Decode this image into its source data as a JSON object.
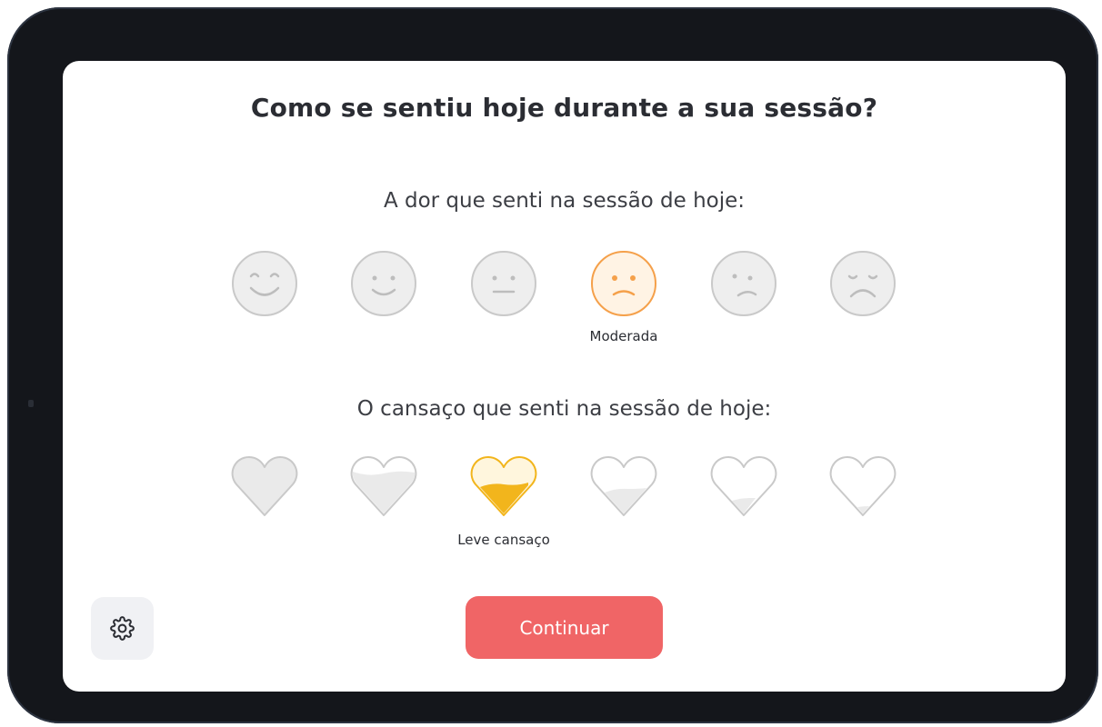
{
  "title": "Como se sentiu hoje durante a sua sessão?",
  "pain": {
    "label": "A dor que senti na sessão de hoje:",
    "selected_label": "Moderada",
    "selected_index": 3,
    "options": [
      {
        "icon": "very-happy-face-icon"
      },
      {
        "icon": "happy-face-icon"
      },
      {
        "icon": "neutral-face-icon"
      },
      {
        "icon": "sad-face-icon"
      },
      {
        "icon": "unhappy-face-icon"
      },
      {
        "icon": "very-sad-face-icon"
      }
    ]
  },
  "fatigue": {
    "label": "O cansaço que senti na sessão de hoje:",
    "selected_label": "Leve cansaço",
    "selected_index": 2,
    "options": [
      {
        "icon": "heart-full-icon",
        "fill_level": 1.0
      },
      {
        "icon": "heart-mostly-full-icon",
        "fill_level": 0.8
      },
      {
        "icon": "heart-half-icon",
        "fill_level": 0.6
      },
      {
        "icon": "heart-low-icon",
        "fill_level": 0.4
      },
      {
        "icon": "heart-very-low-icon",
        "fill_level": 0.2
      },
      {
        "icon": "heart-empty-icon",
        "fill_level": 0.05
      }
    ]
  },
  "continue_label": "Continuar",
  "settings_icon": "gear-icon",
  "colors": {
    "pain_selected": "#f5a04a",
    "fatigue_selected": "#f2b51c",
    "inactive": "#c9c9c9",
    "continue_button": "#f06566"
  }
}
